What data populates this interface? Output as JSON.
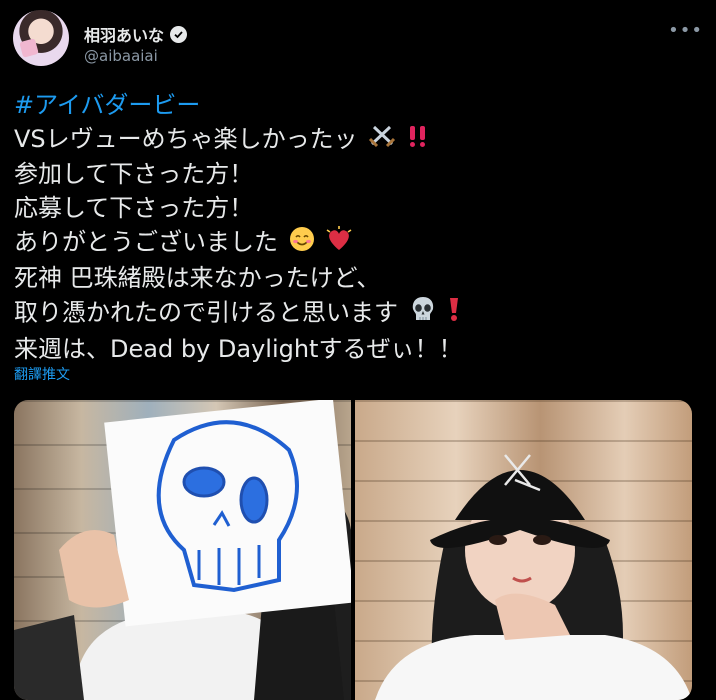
{
  "user": {
    "display_name": "相羽あいな",
    "handle": "@aibaaiai"
  },
  "tweet": {
    "hashtag": "#アイバダービー",
    "lines": [
      "VSレヴューめちゃ楽しかったッ",
      "参加して下さった方！",
      "応募して下さった方！",
      "ありがとうございました",
      "死神 巴珠緒殿は来なかったけど、",
      "取り憑かれたので引けると思います",
      "来週は、Dead by Daylightするぜぃ！！"
    ],
    "emojis": {
      "line1": [
        "crossed-swords-emoji",
        "double-exclamation-emoji"
      ],
      "line4": [
        "smiling-face-emoji",
        "beating-heart-emoji"
      ],
      "line6": [
        "skull-emoji",
        "red-exclamation-emoji"
      ]
    },
    "translate_label": "翻譯推文"
  },
  "media": {
    "photos": [
      {
        "name": "photo-skull-drawing"
      },
      {
        "name": "photo-bucket-hat"
      }
    ]
  },
  "colors": {
    "background": "#000000",
    "text": "#e7e9ea",
    "accent": "#1d9bf0",
    "muted": "#8b98a5"
  }
}
